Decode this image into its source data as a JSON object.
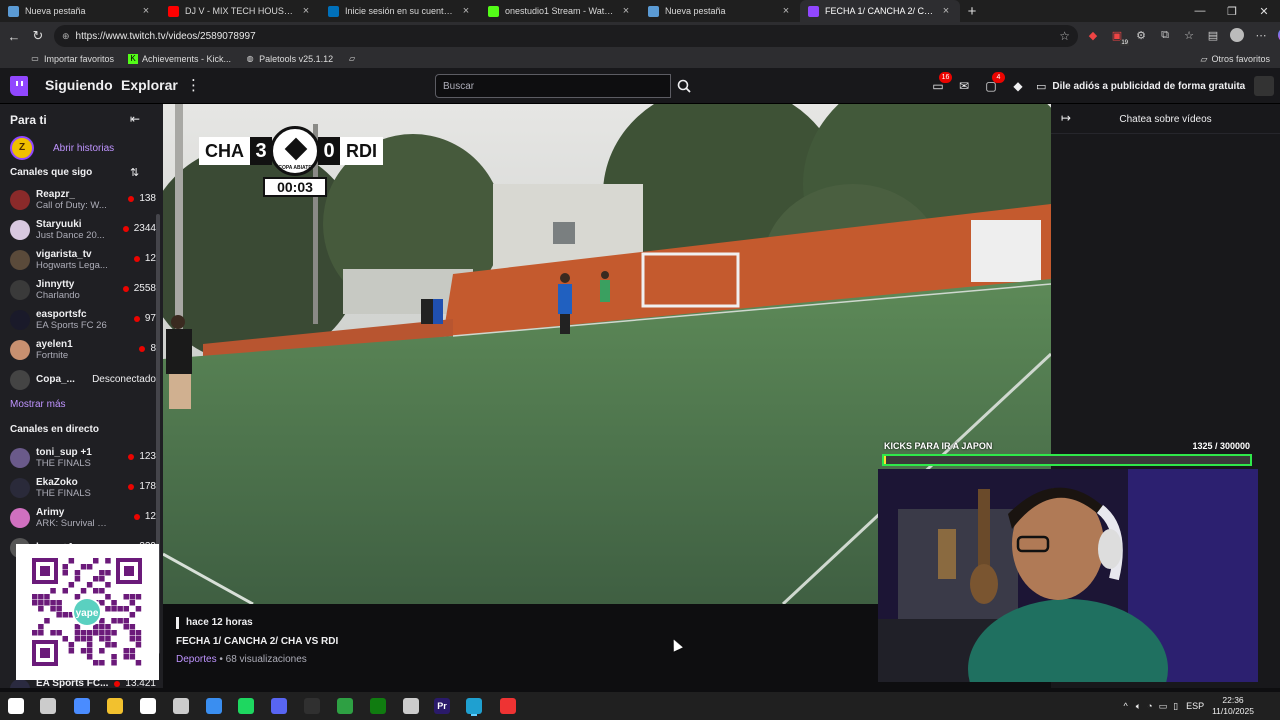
{
  "browser": {
    "tabs": [
      {
        "title": "Nueva pestaña",
        "icon": "browser-tab-icon",
        "color": "#5b9bd5",
        "active": false
      },
      {
        "title": "DJ V - MIX TECH HOUSE ( Al...",
        "icon": "youtube-icon",
        "color": "#ff0000",
        "active": false
      },
      {
        "title": "Inicie sesión en su cuenta de PayPal",
        "icon": "paypal-icon",
        "color": "#0070ba",
        "active": false
      },
      {
        "title": "onestudio1 Stream - Watch Live o...",
        "icon": "kick-icon",
        "color": "#53fc18",
        "active": false
      },
      {
        "title": "Nueva pestaña",
        "icon": "browser-tab-icon",
        "color": "#5b9bd5",
        "active": false
      },
      {
        "title": "FECHA 1/ CANCHA 2/ CHA VS RDI",
        "icon": "twitch-icon",
        "color": "#9147ff",
        "active": true
      }
    ],
    "url": "https://www.twitch.tv/videos/2589078997",
    "bookmarks": [
      {
        "label": "Importar favoritos",
        "icon": "import-icon"
      },
      {
        "label": "Achievements - Kick...",
        "icon": "kick-icon"
      },
      {
        "label": "Paletools v25.1.12",
        "icon": "globe-icon"
      }
    ],
    "other_bookmarks": "Otros favoritos",
    "extension_badge": "19"
  },
  "twitch": {
    "nav": {
      "following": "Siguiendo",
      "browse": "Explorar"
    },
    "search_placeholder": "Buscar",
    "notifications": {
      "inbox": "16",
      "whispers": "4"
    },
    "ad_free": "Dile adiós a publicidad de forma gratuita",
    "sidebar": {
      "title": "Para ti",
      "stories": "Abrir historias",
      "followed_header": "Canales que sigo",
      "followed": [
        {
          "name": "Reapzr_",
          "game": "Call of Duty: W...",
          "viewers": "138",
          "color": "#8a2a2a"
        },
        {
          "name": "Staryuuki",
          "game": "Just Dance 20...",
          "viewers": "2344",
          "color": "#d8c8e0"
        },
        {
          "name": "vigarista_tv",
          "game": "Hogwarts Lega...",
          "viewers": "12",
          "color": "#5a4a3a"
        },
        {
          "name": "Jinnytty",
          "game": "Charlando",
          "viewers": "2558",
          "color": "#3a3a3a"
        },
        {
          "name": "easportsfc",
          "game": "EA Sports FC 26",
          "viewers": "97",
          "color": "#1a1a2a"
        },
        {
          "name": "ayelen1",
          "game": "Fortnite",
          "viewers": "8",
          "color": "#c89070"
        },
        {
          "name": "Copa_...",
          "game": "",
          "viewers": "",
          "status": "Desconectado",
          "color": "#444"
        }
      ],
      "show_more": "Mostrar más",
      "live_header": "Canales en directo",
      "live": [
        {
          "name": "toni_sup +1",
          "game": "THE FINALS",
          "viewers": "123",
          "color": "#6a5a8a"
        },
        {
          "name": "EkaZoko",
          "game": "THE FINALS",
          "viewers": "178",
          "color": "#2a2a3a"
        },
        {
          "name": "Arimy",
          "game": "ARK: Survival E...",
          "viewers": "12",
          "color": "#d070c0"
        },
        {
          "name": "lamp +1",
          "game": "",
          "viewers": "329",
          "color": "#555"
        }
      ],
      "bottom": {
        "name": "EA Sports FC...",
        "viewers": "13.421"
      },
      "qr_brand": "yape"
    },
    "video": {
      "scoreboard": {
        "home": "CHA",
        "home_score": "3",
        "away": "RDI",
        "away_score": "0",
        "league": "COPA ABIATE",
        "clock": "00:03"
      },
      "banner_text": "",
      "age": "hace 12 horas",
      "title": "FECHA 1/ CANCHA 2/ CHA VS RDI",
      "category": "Deportes",
      "views": "• 68 visualizaciones"
    },
    "chat": {
      "title": "Chatea sobre vídeos"
    },
    "overlay": {
      "label": "KICKS PARA IR A JAPON",
      "count": "1325  / 300000",
      "progress": 0.0044,
      "bar_color": "#2fe84a"
    }
  },
  "taskbar": {
    "apps": [
      {
        "name": "windows-start-icon",
        "color": "#ffffff"
      },
      {
        "name": "task-view-icon",
        "color": "#cccccc"
      },
      {
        "name": "copilot-icon",
        "color": "#4a8cff"
      },
      {
        "name": "file-explorer-icon",
        "color": "#f2c12e"
      },
      {
        "name": "store-icon",
        "color": "#ffffff"
      },
      {
        "name": "game-icon",
        "color": "#cccccc"
      },
      {
        "name": "app-blue-icon",
        "color": "#3a8ef0"
      },
      {
        "name": "spotify-icon",
        "color": "#1ed760"
      },
      {
        "name": "discord-icon",
        "color": "#5865f2"
      },
      {
        "name": "obs-icon",
        "color": "#303030"
      },
      {
        "name": "app-green-icon",
        "color": "#2ea043"
      },
      {
        "name": "xbox-icon",
        "color": "#107c10"
      },
      {
        "name": "app-tool-icon",
        "color": "#cccccc"
      },
      {
        "name": "premiere-icon",
        "color": "#2a1a6a",
        "label": "Pr"
      },
      {
        "name": "edge-icon",
        "color": "#1fa0d0"
      },
      {
        "name": "app-red-icon",
        "color": "#e33"
      }
    ],
    "lang": "ESP",
    "time": "22:36",
    "date": "11/10/2025"
  }
}
